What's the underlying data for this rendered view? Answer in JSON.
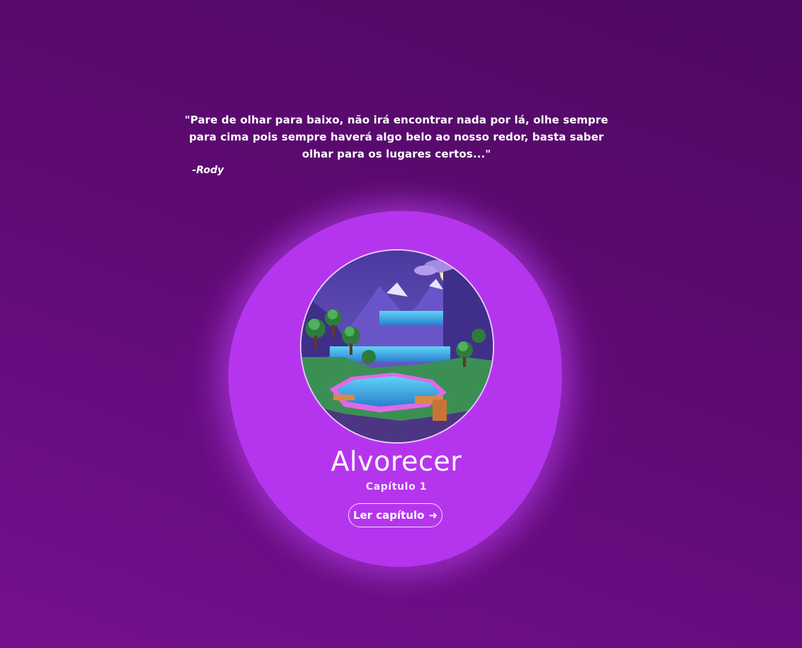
{
  "quote": {
    "text": "\"Pare de olhar para baixo, não irá encontrar nada por lá, olhe sempre para cima pois sempre haverá algo belo ao nosso redor, basta saber olhar para os lugares certos...\"",
    "author": "-Rody"
  },
  "story": {
    "title": "Alvorecer",
    "chapter": "Capítulo 1",
    "read_button_label": "Ler capítulo",
    "read_button_icon": "arrow-right-icon",
    "cover_image": "mountain-lake-illustration"
  },
  "colors": {
    "background": "#5e0a73",
    "blob": "#b535ee",
    "text": "#ffffff"
  }
}
